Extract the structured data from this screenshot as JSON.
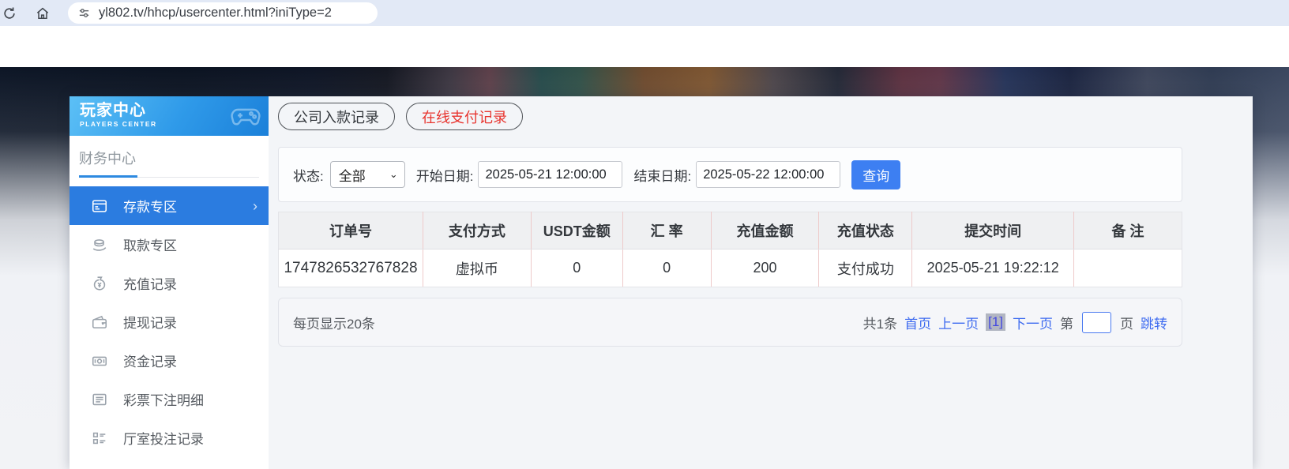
{
  "browser": {
    "url": "yl802.tv/hhcp/usercenter.html?iniType=2"
  },
  "sidebar": {
    "banner": {
      "title": "玩家中心",
      "subtitle": "PLAYERS CENTER"
    },
    "section_title": "财务中心",
    "items": [
      {
        "label": "存款专区",
        "icon": "deposit-card-icon",
        "active": true
      },
      {
        "label": "取款专区",
        "icon": "withdraw-hand-icon",
        "active": false
      },
      {
        "label": "充值记录",
        "icon": "moneybag-icon",
        "active": false
      },
      {
        "label": "提现记录",
        "icon": "wallet-icon",
        "active": false
      },
      {
        "label": "资金记录",
        "icon": "cash-icon",
        "active": false
      },
      {
        "label": "彩票下注明细",
        "icon": "document-lines-icon",
        "active": false
      },
      {
        "label": "厅室投注记录",
        "icon": "checklist-icon",
        "active": false
      }
    ],
    "active_chevron": "›"
  },
  "tabs": [
    {
      "label": "公司入款记录"
    },
    {
      "label": "在线支付记录"
    }
  ],
  "filters": {
    "status_label": "状态:",
    "status_value": "全部",
    "start_label": "开始日期:",
    "start_value": "2025-05-21 12:00:00",
    "end_label": "结束日期:",
    "end_value": "2025-05-22 12:00:00",
    "search_label": "查询"
  },
  "table": {
    "headers": [
      "订单号",
      "支付方式",
      "USDT金额",
      "汇 率",
      "充值金额",
      "充值状态",
      "提交时间",
      "备 注"
    ],
    "rows": [
      [
        "1747826532767828",
        "虚拟币",
        "0",
        "0",
        "200",
        "支付成功",
        "2025-05-21 19:22:12",
        ""
      ]
    ]
  },
  "pagination": {
    "page_size_text": "每页显示20条",
    "total_text": "共1条",
    "first_label": "首页",
    "prev_label": "上一页",
    "current_page": "[1]",
    "next_label": "下一页",
    "jump_prefix": "第",
    "jump_suffix": "页",
    "jump_label": "跳转"
  },
  "colors": {
    "accent_blue": "#3d7ff2",
    "active_menu": "#2b7ce0",
    "tab_red": "#e8352f",
    "link_blue": "#3e6bf0",
    "table_divider_pink": "#eecaca",
    "banner_gradient_start": "#5cc0f6",
    "banner_gradient_end": "#1b80d9"
  }
}
